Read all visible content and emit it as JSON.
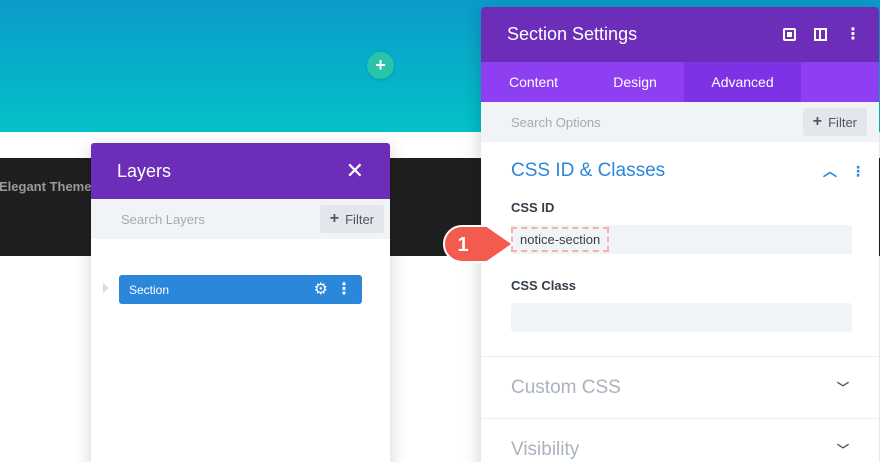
{
  "background": {
    "brand_text": "Elegant Themes",
    "add_icon": "plus-icon",
    "colors": {
      "hero_top": "#0b9bc9",
      "hero_bottom": "#03c2c9",
      "dark_band": "#1f1f1f",
      "add_button": "#29c4a9"
    }
  },
  "layers_panel": {
    "title": "Layers",
    "close_icon": "close-icon",
    "search_placeholder": "Search Layers",
    "filter_label": "Filter",
    "items": [
      {
        "label": "Section"
      }
    ],
    "colors": {
      "header": "#6c2eb9",
      "item": "#2b87da"
    }
  },
  "settings_panel": {
    "title": "Section Settings",
    "header_icons": [
      "fullscreen-icon",
      "split-view-icon",
      "more-options-icon"
    ],
    "tabs": [
      {
        "label": "Content",
        "active": false
      },
      {
        "label": "Design",
        "active": false
      },
      {
        "label": "Advanced",
        "active": true
      }
    ],
    "search_placeholder": "Search Options",
    "filter_label": "Filter",
    "group": {
      "title": "CSS ID & Classes",
      "expanded": true,
      "fields": [
        {
          "label": "CSS ID",
          "value": "notice-section"
        },
        {
          "label": "CSS Class",
          "value": ""
        }
      ]
    },
    "collapsed_groups": [
      {
        "title": "Custom CSS"
      },
      {
        "title": "Visibility"
      }
    ],
    "colors": {
      "header": "#6c2eb9",
      "tabs": "#8d3ff1",
      "active_tab": "#7d32e5",
      "group_title": "#2b87da"
    }
  },
  "callout": {
    "number": "1",
    "color": "#f35b4f"
  }
}
